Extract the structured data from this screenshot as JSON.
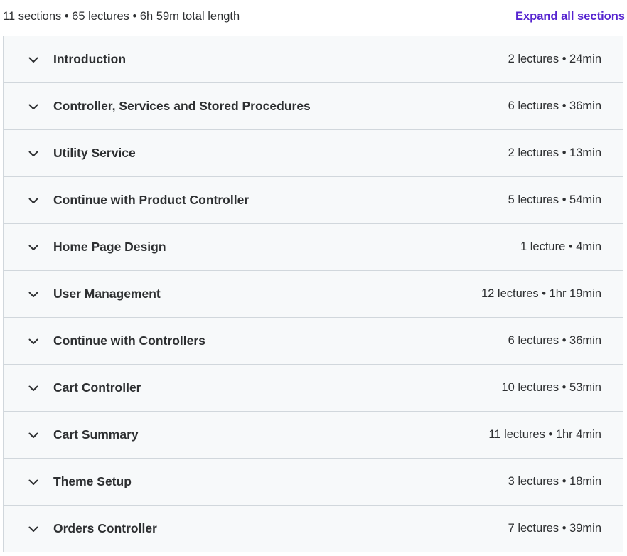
{
  "summary": {
    "text": "11 sections • 65 lectures • 6h 59m total length",
    "expand_all_label": "Expand all sections"
  },
  "colors": {
    "accent": "#5624d0",
    "row_background": "#f7f9fa",
    "border": "#d1d7dc",
    "text": "#2d2f31"
  },
  "sections": [
    {
      "title": "Introduction",
      "meta": "2 lectures • 24min",
      "icon": "chevron-down-icon"
    },
    {
      "title": "Controller, Services and Stored Procedures",
      "meta": "6 lectures • 36min",
      "icon": "chevron-down-icon"
    },
    {
      "title": "Utility Service",
      "meta": "2 lectures • 13min",
      "icon": "chevron-down-icon"
    },
    {
      "title": "Continue with Product Controller",
      "meta": "5 lectures • 54min",
      "icon": "chevron-down-icon"
    },
    {
      "title": "Home Page Design",
      "meta": "1 lecture • 4min",
      "icon": "chevron-down-icon"
    },
    {
      "title": "User Management",
      "meta": "12 lectures • 1hr 19min",
      "icon": "chevron-down-icon"
    },
    {
      "title": "Continue with Controllers",
      "meta": "6 lectures • 36min",
      "icon": "chevron-down-icon"
    },
    {
      "title": "Cart Controller",
      "meta": "10 lectures • 53min",
      "icon": "chevron-down-icon"
    },
    {
      "title": "Cart Summary",
      "meta": "11 lectures • 1hr 4min",
      "icon": "chevron-down-icon"
    },
    {
      "title": "Theme Setup",
      "meta": "3 lectures • 18min",
      "icon": "chevron-down-icon"
    },
    {
      "title": "Orders Controller",
      "meta": "7 lectures • 39min",
      "icon": "chevron-down-icon"
    }
  ]
}
